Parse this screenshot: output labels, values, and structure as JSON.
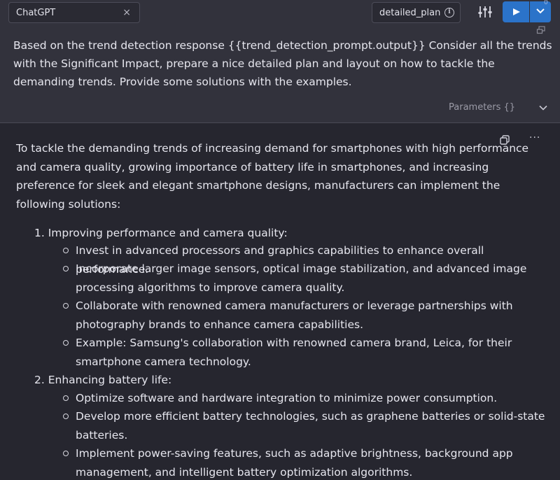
{
  "toolbar": {
    "model_label": "ChatGPT",
    "close_glyph": "×",
    "prompt_name": "detailed_plan",
    "info_glyph": "i",
    "run_icon": "play-icon",
    "dropdown_icon": "chevron-down-icon",
    "cursor_glyph": "0",
    "accent_color": "#2b73c9"
  },
  "prompt": {
    "text": "Based on the trend detection response {{trend_detection_prompt.output}} Consider all the trends with the Significant Impact, prepare a nice detailed plan and layout on how to tackle the demanding trends. Provide some solutions with the examples."
  },
  "parameters": {
    "label": "Parameters {}"
  },
  "response": {
    "more_glyph": "···",
    "intro": "To tackle the demanding trends of increasing demand for smartphones with high performance and camera quality, growing importance of battery life in smartphones, and increasing preference for sleek and elegant smartphone designs, manufacturers can implement the following solutions:",
    "sections": [
      {
        "title": "1. Improving performance and camera quality:",
        "bullets": [
          "Invest in advanced processors and graphics capabilities to enhance overall performance.",
          "Incorporate larger image sensors, optical image stabilization, and advanced image processing algorithms to improve camera quality.",
          "Collaborate with renowned camera manufacturers or leverage partnerships with photography brands to enhance camera capabilities.",
          "Example: Samsung's collaboration with renowned camera brand, Leica, for their smartphone camera technology."
        ]
      },
      {
        "title": "2. Enhancing battery life:",
        "bullets": [
          "Optimize software and hardware integration to minimize power consumption.",
          "Develop more efficient battery technologies, such as graphene batteries or solid-state batteries.",
          "Implement power-saving features, such as adaptive brightness, background app management, and intelligent battery optimization algorithms."
        ]
      }
    ]
  }
}
